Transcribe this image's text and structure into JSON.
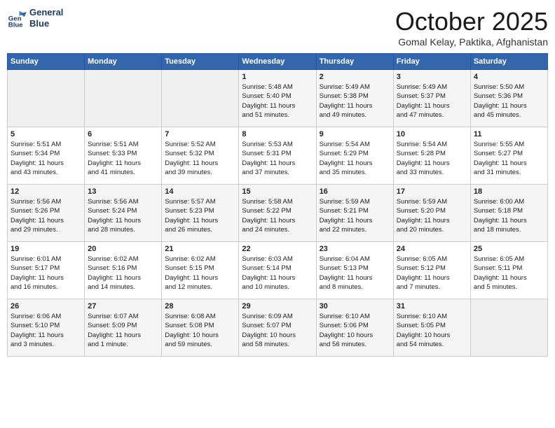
{
  "logo": {
    "line1": "General",
    "line2": "Blue"
  },
  "title": "October 2025",
  "subtitle": "Gomal Kelay, Paktika, Afghanistan",
  "days_of_week": [
    "Sunday",
    "Monday",
    "Tuesday",
    "Wednesday",
    "Thursday",
    "Friday",
    "Saturday"
  ],
  "weeks": [
    [
      {
        "day": "",
        "info": ""
      },
      {
        "day": "",
        "info": ""
      },
      {
        "day": "",
        "info": ""
      },
      {
        "day": "1",
        "info": "Sunrise: 5:48 AM\nSunset: 5:40 PM\nDaylight: 11 hours\nand 51 minutes."
      },
      {
        "day": "2",
        "info": "Sunrise: 5:49 AM\nSunset: 5:38 PM\nDaylight: 11 hours\nand 49 minutes."
      },
      {
        "day": "3",
        "info": "Sunrise: 5:49 AM\nSunset: 5:37 PM\nDaylight: 11 hours\nand 47 minutes."
      },
      {
        "day": "4",
        "info": "Sunrise: 5:50 AM\nSunset: 5:36 PM\nDaylight: 11 hours\nand 45 minutes."
      }
    ],
    [
      {
        "day": "5",
        "info": "Sunrise: 5:51 AM\nSunset: 5:34 PM\nDaylight: 11 hours\nand 43 minutes."
      },
      {
        "day": "6",
        "info": "Sunrise: 5:51 AM\nSunset: 5:33 PM\nDaylight: 11 hours\nand 41 minutes."
      },
      {
        "day": "7",
        "info": "Sunrise: 5:52 AM\nSunset: 5:32 PM\nDaylight: 11 hours\nand 39 minutes."
      },
      {
        "day": "8",
        "info": "Sunrise: 5:53 AM\nSunset: 5:31 PM\nDaylight: 11 hours\nand 37 minutes."
      },
      {
        "day": "9",
        "info": "Sunrise: 5:54 AM\nSunset: 5:29 PM\nDaylight: 11 hours\nand 35 minutes."
      },
      {
        "day": "10",
        "info": "Sunrise: 5:54 AM\nSunset: 5:28 PM\nDaylight: 11 hours\nand 33 minutes."
      },
      {
        "day": "11",
        "info": "Sunrise: 5:55 AM\nSunset: 5:27 PM\nDaylight: 11 hours\nand 31 minutes."
      }
    ],
    [
      {
        "day": "12",
        "info": "Sunrise: 5:56 AM\nSunset: 5:26 PM\nDaylight: 11 hours\nand 29 minutes."
      },
      {
        "day": "13",
        "info": "Sunrise: 5:56 AM\nSunset: 5:24 PM\nDaylight: 11 hours\nand 28 minutes."
      },
      {
        "day": "14",
        "info": "Sunrise: 5:57 AM\nSunset: 5:23 PM\nDaylight: 11 hours\nand 26 minutes."
      },
      {
        "day": "15",
        "info": "Sunrise: 5:58 AM\nSunset: 5:22 PM\nDaylight: 11 hours\nand 24 minutes."
      },
      {
        "day": "16",
        "info": "Sunrise: 5:59 AM\nSunset: 5:21 PM\nDaylight: 11 hours\nand 22 minutes."
      },
      {
        "day": "17",
        "info": "Sunrise: 5:59 AM\nSunset: 5:20 PM\nDaylight: 11 hours\nand 20 minutes."
      },
      {
        "day": "18",
        "info": "Sunrise: 6:00 AM\nSunset: 5:18 PM\nDaylight: 11 hours\nand 18 minutes."
      }
    ],
    [
      {
        "day": "19",
        "info": "Sunrise: 6:01 AM\nSunset: 5:17 PM\nDaylight: 11 hours\nand 16 minutes."
      },
      {
        "day": "20",
        "info": "Sunrise: 6:02 AM\nSunset: 5:16 PM\nDaylight: 11 hours\nand 14 minutes."
      },
      {
        "day": "21",
        "info": "Sunrise: 6:02 AM\nSunset: 5:15 PM\nDaylight: 11 hours\nand 12 minutes."
      },
      {
        "day": "22",
        "info": "Sunrise: 6:03 AM\nSunset: 5:14 PM\nDaylight: 11 hours\nand 10 minutes."
      },
      {
        "day": "23",
        "info": "Sunrise: 6:04 AM\nSunset: 5:13 PM\nDaylight: 11 hours\nand 8 minutes."
      },
      {
        "day": "24",
        "info": "Sunrise: 6:05 AM\nSunset: 5:12 PM\nDaylight: 11 hours\nand 7 minutes."
      },
      {
        "day": "25",
        "info": "Sunrise: 6:05 AM\nSunset: 5:11 PM\nDaylight: 11 hours\nand 5 minutes."
      }
    ],
    [
      {
        "day": "26",
        "info": "Sunrise: 6:06 AM\nSunset: 5:10 PM\nDaylight: 11 hours\nand 3 minutes."
      },
      {
        "day": "27",
        "info": "Sunrise: 6:07 AM\nSunset: 5:09 PM\nDaylight: 11 hours\nand 1 minute."
      },
      {
        "day": "28",
        "info": "Sunrise: 6:08 AM\nSunset: 5:08 PM\nDaylight: 10 hours\nand 59 minutes."
      },
      {
        "day": "29",
        "info": "Sunrise: 6:09 AM\nSunset: 5:07 PM\nDaylight: 10 hours\nand 58 minutes."
      },
      {
        "day": "30",
        "info": "Sunrise: 6:10 AM\nSunset: 5:06 PM\nDaylight: 10 hours\nand 56 minutes."
      },
      {
        "day": "31",
        "info": "Sunrise: 6:10 AM\nSunset: 5:05 PM\nDaylight: 10 hours\nand 54 minutes."
      },
      {
        "day": "",
        "info": ""
      }
    ]
  ]
}
